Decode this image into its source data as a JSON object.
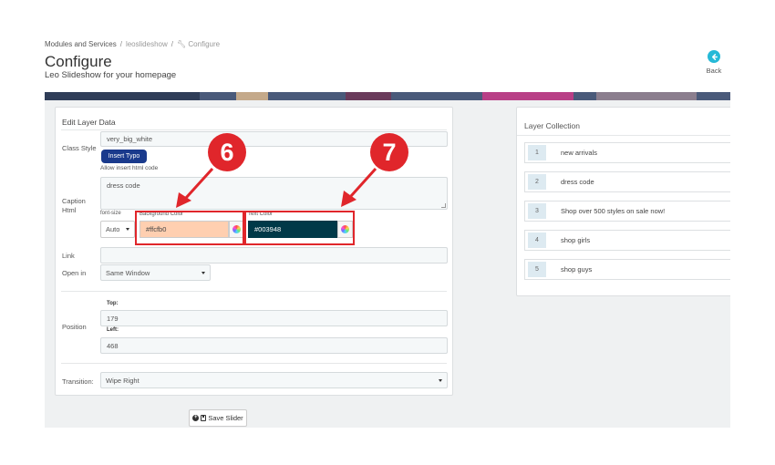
{
  "breadcrumb": {
    "item1": "Modules and Services",
    "item2": "leoslideshow",
    "item3": "Configure",
    "separator": "/"
  },
  "header": {
    "title": "Configure",
    "subtitle": "Leo Slideshow for your homepage",
    "back_label": "Back"
  },
  "edit_panel": {
    "heading": "Edit Layer Data",
    "class_style_label": "Class Style",
    "class_style_value": "very_big_white",
    "insert_typo_label": "Insert Typo",
    "allow_html_hint": "Allow insert html code",
    "caption_label_1": "Caption",
    "caption_label_2": "Html",
    "caption_value": "dress code",
    "font_size_label": "font-size",
    "font_size_value": "Auto",
    "bg_color_label": "Background Color",
    "bg_color_value": "#ffcfb0",
    "text_color_label": "Text Color",
    "text_color_value": "#003948",
    "link_label": "Link",
    "link_value": "",
    "open_in_label": "Open in",
    "open_in_value": "Same Window",
    "position_label": "Position",
    "top_label": "Top:",
    "top_value": "179",
    "left_label": "Left:",
    "left_value": "468",
    "transition_label": "Transition:",
    "transition_value": "Wipe Right"
  },
  "layer_collection": {
    "title": "Layer Collection",
    "items": [
      {
        "num": "1",
        "label": "new arrivals"
      },
      {
        "num": "2",
        "label": "dress code"
      },
      {
        "num": "3",
        "label": "Shop over 500 styles on sale now!"
      },
      {
        "num": "4",
        "label": "shop girls"
      },
      {
        "num": "5",
        "label": "shop guys"
      }
    ]
  },
  "save_button": {
    "label": "Save Slider"
  },
  "annotations": {
    "callout_6": "6",
    "callout_7": "7"
  },
  "colors": {
    "accent": "#25b9d7",
    "primary_button": "#1a3a8c",
    "highlight_red": "#e0262b",
    "bg_swatch": "#ffcfb0",
    "text_swatch": "#003948"
  }
}
